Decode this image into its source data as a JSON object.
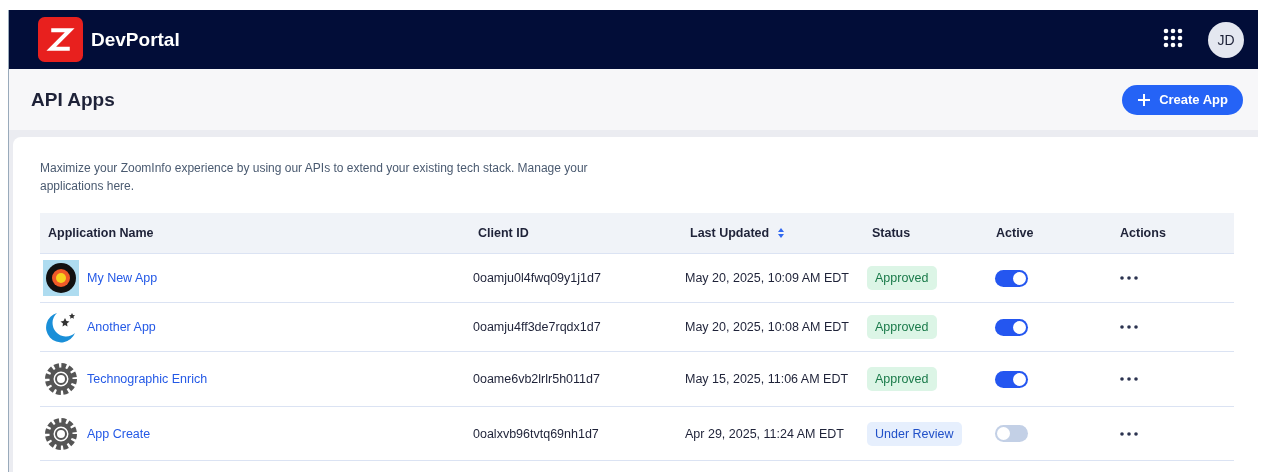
{
  "header": {
    "brand": "DevPortal",
    "avatar": "JD"
  },
  "page": {
    "title": "API Apps",
    "create_button": "Create App"
  },
  "intro": "Maximize your ZoomInfo experience by using our APIs to extend your existing tech stack. Manage your applications here.",
  "table": {
    "columns": [
      "Application Name",
      "Client ID",
      "Last Updated",
      "Status",
      "Active",
      "Actions"
    ],
    "rows": [
      {
        "kind": "flower",
        "name": "My New App",
        "client_id": "0oamju0l4fwq09y1j1d7",
        "updated": "May 20, 2025, 10:09 AM EDT",
        "status": {
          "label": "Approved",
          "kind": "approved"
        },
        "active": true
      },
      {
        "kind": "moon",
        "name": "Another App",
        "client_id": "0oamju4ff3de7rqdx1d7",
        "updated": "May 20, 2025, 10:08 AM EDT",
        "status": {
          "label": "Approved",
          "kind": "approved"
        },
        "active": true
      },
      {
        "kind": "gear",
        "name": "Technographic Enrich",
        "client_id": "0oame6vb2lrlr5h011d7",
        "updated": "May 15, 2025, 11:06 AM EDT",
        "status": {
          "label": "Approved",
          "kind": "approved"
        },
        "active": true
      },
      {
        "kind": "gear",
        "name": "App Create",
        "client_id": "0oalxvb96tvtq69nh1d7",
        "updated": "Apr 29, 2025, 11:24 AM EDT",
        "status": {
          "label": "Under Review",
          "kind": "review"
        },
        "active": false
      }
    ]
  }
}
